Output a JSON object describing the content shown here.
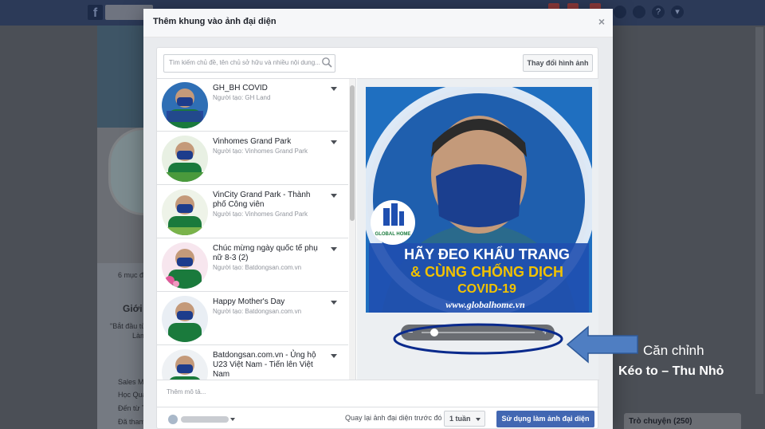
{
  "dialog": {
    "title": "Thêm khung vào ảnh đại diện",
    "close_label": "×",
    "search_placeholder": "Tìm kiếm chủ đề, tên chủ sở hữu và nhiều nội dung...",
    "change_image_label": "Thay đổi hình ảnh",
    "frames": [
      {
        "name": "GH_BH COVID",
        "author": "Người tạo: GH Land"
      },
      {
        "name": "Vinhomes Grand Park",
        "author": "Người tạo: Vinhomes Grand Park"
      },
      {
        "name": "VinCity Grand Park - Thành phố Công viên",
        "author": "Người tạo: Vinhomes Grand Park"
      },
      {
        "name": "Chúc mừng ngày quốc tế phụ nữ 8-3 (2)",
        "author": "Người tạo: Batdongsan.com.vn"
      },
      {
        "name": "Happy Mother's Day",
        "author": "Người tạo: Batdongsan.com.vn"
      },
      {
        "name": "Batdongsan.com.vn - Ủng hộ U23 Việt Nam - Tiến lên Việt Nam",
        "author": ""
      }
    ],
    "preview": {
      "logo_text": "GLOBAL HOME",
      "line1": "HÃY ĐEO KHẨU TRANG",
      "line2": "& CÙNG CHỐNG DỊCH",
      "line3": "COVID-19",
      "website": "www.globalhome.vn"
    },
    "zoom": {
      "minus": "−",
      "plus": "+",
      "level": 0.04
    },
    "description_placeholder": "Thêm mô tả...",
    "revert_label": "Quay lại ảnh đại diện trước đó",
    "revert_value": "1 tuần",
    "use_button": "Sử dụng làm ảnh đại diện"
  },
  "background": {
    "fb_logo": "f",
    "chat_label": "Trò chuyện (250)",
    "left_texts": [
      "6 mục đ",
      "Giới t",
      "\"Bắt đầu từ",
      "Làm",
      "Sales Ma",
      "Học Quả",
      "Đến từ T",
      "Đã tham"
    ]
  },
  "annotation": {
    "line1": "Căn chỉnh",
    "line2": "Kéo to – Thu Nhỏ",
    "color": "#0a2a8c",
    "arrow_color": "#4f7ec2"
  },
  "colors": {
    "primary_button": "#4267b2",
    "header_bar": "#2c3a58"
  }
}
